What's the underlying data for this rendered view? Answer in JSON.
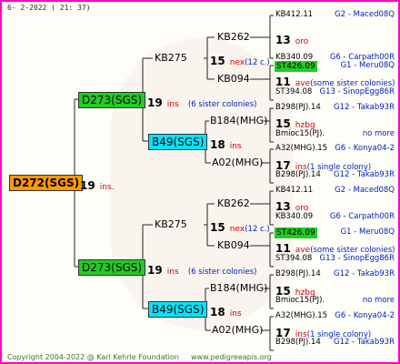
{
  "header": {
    "date": "6-  2-2022 ( 21: 37)"
  },
  "footer": {
    "copyright": "Copyright 2004-2022 @ Karl Kehrle Foundation",
    "website": "www.pedigreeapis.org"
  },
  "root": {
    "name": "D272(SGS)",
    "year": "19",
    "ins": "ins."
  },
  "branches": [
    {
      "name": "D273(SGS)",
      "year": "19",
      "ins": "ins",
      "siblings": "(6 sister colonies)",
      "sire": {
        "name": "KB275",
        "year": "15",
        "ins": "nex",
        "siblings": "(12 c.)",
        "sire": {
          "name": "KB262",
          "year": "13",
          "ins": "oro",
          "a1": {
            "id": "KB412.11",
            "place": "G2 - Maced08Q"
          },
          "a2": {
            "id": "KB340.09",
            "place": "G6 - Carpath00R"
          }
        },
        "dam": {
          "name": "KB094",
          "year": "11",
          "ins": "ave",
          "siblings": "(some sister colonies)",
          "a1": {
            "id": "ST426.09",
            "place": "G1 - Meru08Q"
          },
          "a2": {
            "id": "ST394.08",
            "place": "G13 - SinopEgg86R"
          }
        }
      },
      "dam": {
        "name": "B49(SGS)",
        "year": "18",
        "ins": "ins",
        "sire": {
          "name": "B184(MHG)",
          "year": "15",
          "ins": "hzbg",
          "a1": {
            "id": "B298(PJ).14",
            "place": "G12 - Takab93R"
          },
          "a2": {
            "id": "Bmioc15(PJ).",
            "place": "no more"
          }
        },
        "dam": {
          "name": "A02(MHG)",
          "year": "17",
          "ins": "ins",
          "siblings": "(1 single colony)",
          "a1": {
            "id": "A32(MHG).15",
            "place": "G6 - Konya04-2"
          },
          "a2": {
            "id": "B298(PJ).14",
            "place": "G12 - Takab93R"
          }
        }
      }
    },
    {
      "name": "D273(SGS)",
      "year": "19",
      "ins": "ins",
      "siblings": "(6 sister colonies)",
      "sire": {
        "name": "KB275",
        "year": "15",
        "ins": "nex",
        "siblings": "(12 c.)",
        "sire": {
          "name": "KB262",
          "year": "13",
          "ins": "oro",
          "a1": {
            "id": "KB412.11",
            "place": "G2 - Maced08Q"
          },
          "a2": {
            "id": "KB340.09",
            "place": "G6 - Carpath00R"
          }
        },
        "dam": {
          "name": "KB094",
          "year": "11",
          "ins": "ave",
          "siblings": "(some sister colonies)",
          "a1": {
            "id": "ST426.09",
            "place": "G1 - Meru08Q"
          },
          "a2": {
            "id": "ST394.08",
            "place": "G13 - SinopEgg86R"
          }
        }
      },
      "dam": {
        "name": "B49(SGS)",
        "year": "18",
        "ins": "ins",
        "sire": {
          "name": "B184(MHG)",
          "year": "15",
          "ins": "hzbg",
          "a1": {
            "id": "B298(PJ).14",
            "place": "G12 - Takab93R"
          },
          "a2": {
            "id": "Bmioc15(PJ).",
            "place": "no more"
          }
        },
        "dam": {
          "name": "A02(MHG)",
          "year": "17",
          "ins": "ins",
          "siblings": "(1 single colony)",
          "a1": {
            "id": "A32(MHG).15",
            "place": "G6 - Konya04-2"
          },
          "a2": {
            "id": "B298(PJ).14",
            "place": "G12 - Takab93R"
          }
        }
      }
    }
  ]
}
